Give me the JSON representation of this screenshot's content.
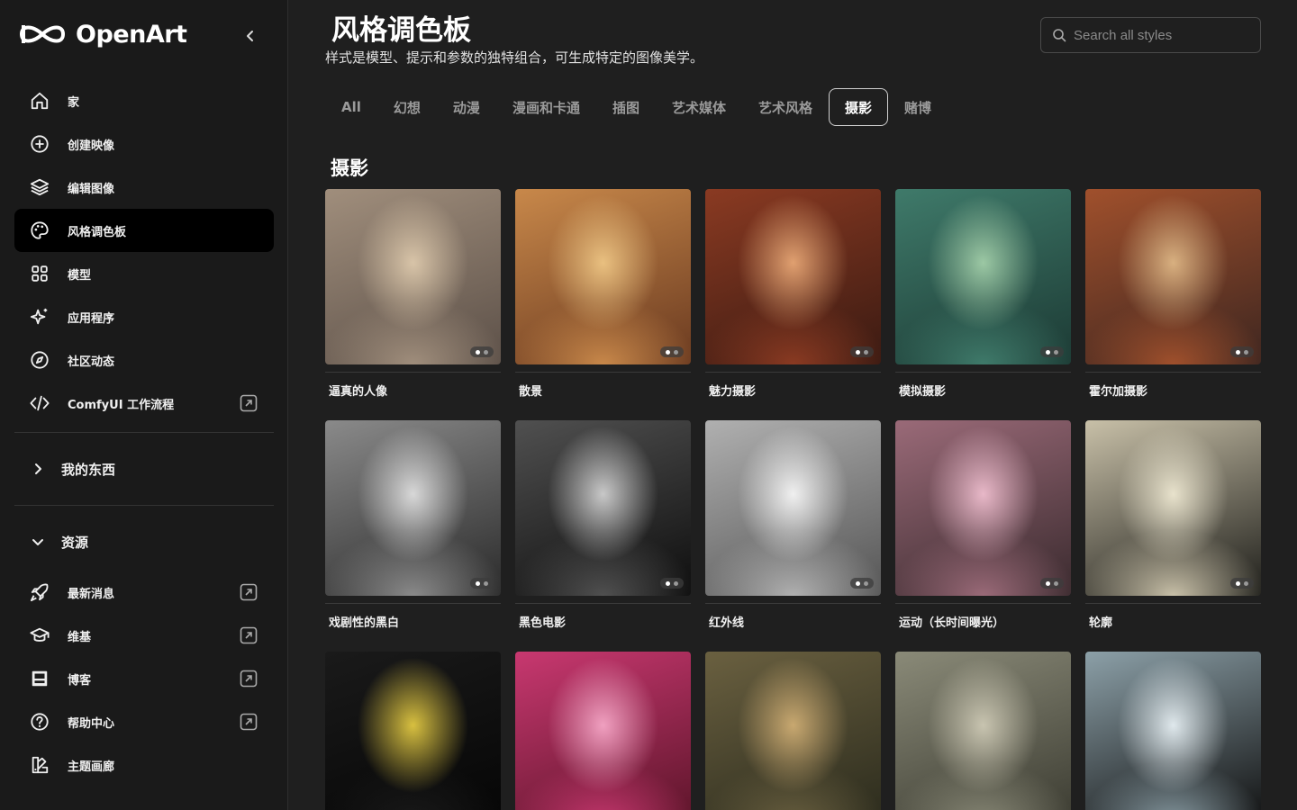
{
  "app": {
    "name": "OpenArt"
  },
  "sidebar": {
    "nav": [
      {
        "label": "家",
        "icon": "home-icon"
      },
      {
        "label": "创建映像",
        "icon": "plus-circle-icon"
      },
      {
        "label": "编辑图像",
        "icon": "layers-icon"
      },
      {
        "label": "风格调色板",
        "icon": "palette-icon",
        "active": true
      },
      {
        "label": "模型",
        "icon": "grid-icon"
      },
      {
        "label": "应用程序",
        "icon": "sparkle-icon"
      },
      {
        "label": "社区动态",
        "icon": "compass-icon"
      },
      {
        "label": "ComfyUI 工作流程",
        "icon": "code-icon",
        "external": true
      }
    ],
    "my_stuff": {
      "label": "我的东西",
      "icon": "chevron-right-icon"
    },
    "resources": {
      "label": "资源",
      "icon": "chevron-down-icon",
      "items": [
        {
          "label": "最新消息",
          "icon": "rocket-icon",
          "external": true
        },
        {
          "label": "维基",
          "icon": "graduation-cap-icon",
          "external": true
        },
        {
          "label": "博客",
          "icon": "blog-icon",
          "external": true
        },
        {
          "label": "帮助中心",
          "icon": "help-circle-icon",
          "external": true
        },
        {
          "label": "主题画廊",
          "icon": "theme-gallery-icon"
        }
      ]
    }
  },
  "header": {
    "title": "风格调色板",
    "subtitle": "样式是模型、提示和参数的独特组合，可生成特定的图像美学。",
    "search_placeholder": "Search all styles"
  },
  "tabs": [
    "All",
    "幻想",
    "动漫",
    "漫画和卡通",
    "插图",
    "艺术媒体",
    "艺术风格",
    "摄影",
    "赌博"
  ],
  "active_tab": "摄影",
  "section": {
    "title": "摄影"
  },
  "styles": [
    {
      "name": "逼真的人像",
      "palette": [
        "#a08e7c",
        "#5c5048",
        "#d8c4a8"
      ]
    },
    {
      "name": "散景",
      "palette": [
        "#c8884a",
        "#6a3a20",
        "#e9c080"
      ]
    },
    {
      "name": "魅力摄影",
      "palette": [
        "#8a3a22",
        "#3a1a12",
        "#e0a070"
      ]
    },
    {
      "name": "模拟摄影",
      "palette": [
        "#3f7a6a",
        "#1c3a34",
        "#9cc8a4"
      ]
    },
    {
      "name": "霍尔加摄影",
      "palette": [
        "#a0502c",
        "#3e2620",
        "#d8b080"
      ]
    },
    {
      "name": "戏剧性的黑白",
      "palette": [
        "#8a8a8a",
        "#2a2a2a",
        "#d8d8d8"
      ]
    },
    {
      "name": "黑色电影",
      "palette": [
        "#505050",
        "#0e0e0e",
        "#c8c8c8"
      ]
    },
    {
      "name": "红外线",
      "palette": [
        "#b0b0b0",
        "#555555",
        "#f0f0f0"
      ]
    },
    {
      "name": "运动（长时间曝光）",
      "palette": [
        "#9a6a78",
        "#3a2a2e",
        "#e8b8c8"
      ]
    },
    {
      "name": "轮廓",
      "palette": [
        "#c8c0a8",
        "#1e1e1a",
        "#e8e2cc"
      ]
    },
    {
      "name": "",
      "palette": [
        "#1a1a1a",
        "#050505",
        "#d8c040"
      ]
    },
    {
      "name": "",
      "palette": [
        "#c83870",
        "#5a1428",
        "#f0a0c0"
      ]
    },
    {
      "name": "",
      "palette": [
        "#6a6040",
        "#2a2a1c",
        "#c8a870"
      ]
    },
    {
      "name": "",
      "palette": [
        "#8a8a78",
        "#3a3a30",
        "#c8c4b0"
      ]
    },
    {
      "name": "",
      "palette": [
        "#8ca0a8",
        "#0e0e0e",
        "#dfe8ec"
      ]
    }
  ]
}
